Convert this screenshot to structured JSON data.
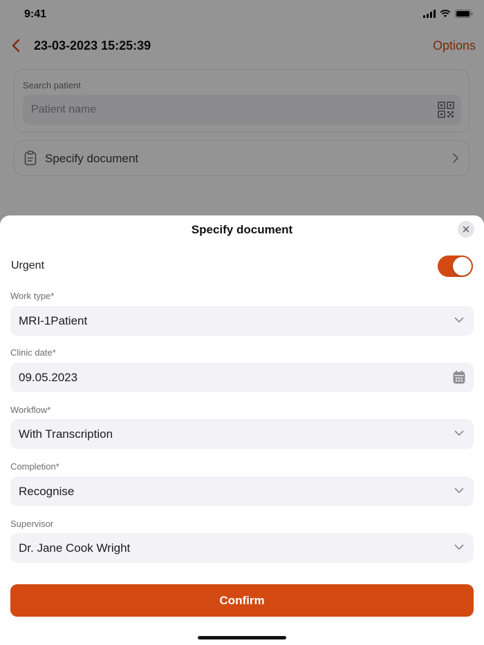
{
  "status_bar": {
    "time": "9:41"
  },
  "nav": {
    "title": "23-03-2023 15:25:39",
    "options_label": "Options"
  },
  "search": {
    "label": "Search patient",
    "placeholder": "Patient name"
  },
  "document_row": {
    "label": "Specify document"
  },
  "sheet": {
    "title": "Specify document",
    "urgent": {
      "label": "Urgent",
      "on": true
    },
    "fields": {
      "work_type": {
        "label": "Work type*",
        "value": "MRI-1Patient"
      },
      "clinic_date": {
        "label": "Clinic date*",
        "value": "09.05.2023"
      },
      "workflow": {
        "label": "Workflow*",
        "value": "With Transcription"
      },
      "completion": {
        "label": "Completion*",
        "value": "Recognise"
      },
      "supervisor": {
        "label": "Supervisor",
        "value": "Dr. Jane Cook Wright"
      }
    },
    "confirm_label": "Confirm"
  },
  "colors": {
    "accent": "#d24a12",
    "field_bg": "#f2f2f7",
    "label": "#6d6d72"
  },
  "icons": [
    "back-chevron-icon",
    "signal-icon",
    "wifi-icon",
    "battery-icon",
    "qr-code-icon",
    "clipboard-icon",
    "chevron-right-icon",
    "close-icon",
    "chevron-down-icon",
    "calendar-icon"
  ]
}
